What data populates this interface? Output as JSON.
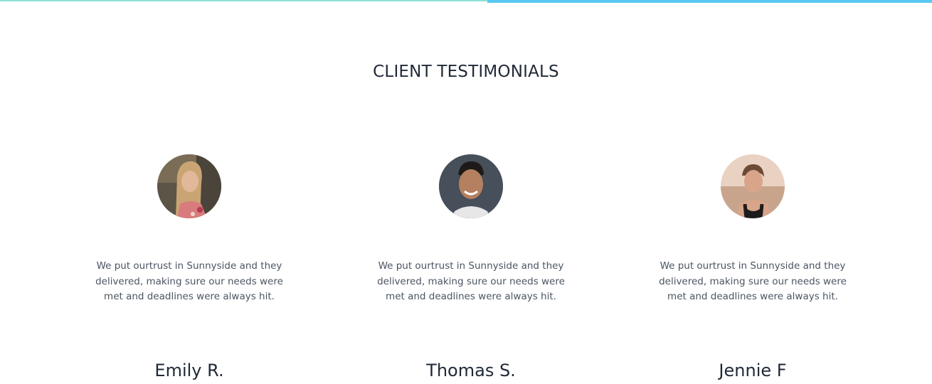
{
  "section": {
    "title": "CLIENT TESTIMONIALS"
  },
  "colors": {
    "top_bar_left": "#8fe0d8",
    "top_bar_right": "#5ac8f2",
    "title_text": "#1f2937",
    "body_text": "#4b5563"
  },
  "testimonials": [
    {
      "avatar_icon": "woman-portrait-photo",
      "quote": "We put ourtrust in Sunnyside and they delivered, making sure our needs were met and deadlines were always hit.",
      "name": "Emily R."
    },
    {
      "avatar_icon": "man-portrait-photo",
      "quote": "We put ourtrust in Sunnyside and they delivered, making sure our needs were met and deadlines were always hit.",
      "name": "Thomas S."
    },
    {
      "avatar_icon": "woman-portrait-photo",
      "quote": "We put ourtrust in Sunnyside and they delivered, making sure our needs were met and deadlines were always hit.",
      "name": "Jennie F"
    }
  ]
}
